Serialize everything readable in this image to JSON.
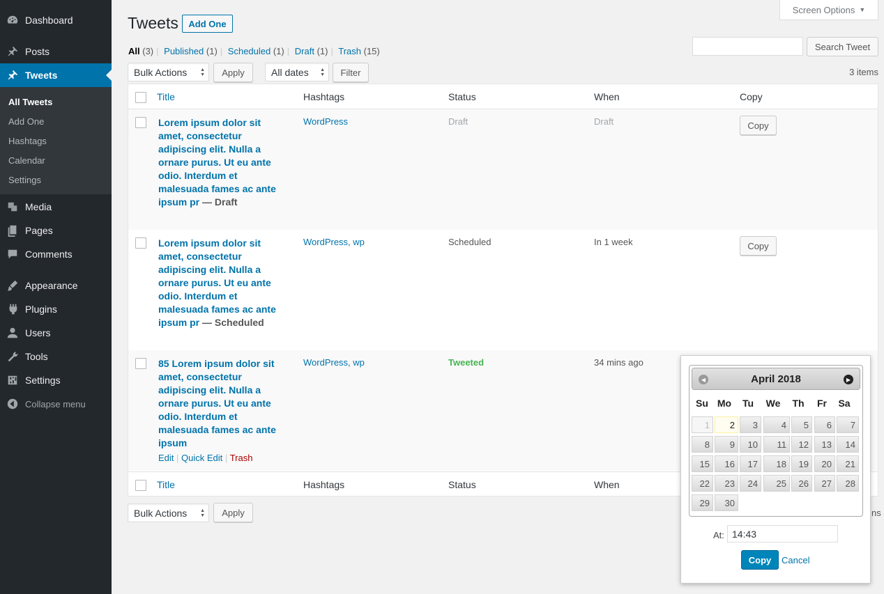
{
  "sidebar": {
    "dashboard": "Dashboard",
    "posts": "Posts",
    "tweets": "Tweets",
    "submenu": [
      "All Tweets",
      "Add One",
      "Hashtags",
      "Calendar",
      "Settings"
    ],
    "media": "Media",
    "pages": "Pages",
    "comments": "Comments",
    "appearance": "Appearance",
    "plugins": "Plugins",
    "users": "Users",
    "tools": "Tools",
    "settings": "Settings",
    "collapse": "Collapse menu"
  },
  "header": {
    "title": "Tweets",
    "add_one": "Add One",
    "screen_options": "Screen Options",
    "screen_options_caret": "▼"
  },
  "views": [
    {
      "label": "All",
      "count": "(3)"
    },
    {
      "label": "Published",
      "count": "(1)"
    },
    {
      "label": "Scheduled",
      "count": "(1)"
    },
    {
      "label": "Draft",
      "count": "(1)"
    },
    {
      "label": "Trash",
      "count": "(15)"
    }
  ],
  "views_sep": "|",
  "search": {
    "value": "",
    "button": "Search Tweet"
  },
  "filters": {
    "bulk_actions": "Bulk Actions",
    "apply": "Apply",
    "dates": "All dates",
    "filter": "Filter",
    "items": "3 items"
  },
  "columns": {
    "title": "Title",
    "hashtags": "Hashtags",
    "status": "Status",
    "when": "When",
    "copy": "Copy"
  },
  "rows": [
    {
      "title": "Lorem ipsum dolor sit amet, consectetur adipiscing elit. Nulla a ornare purus. Ut eu ante odio. Interdum et malesuada fames ac ante ipsum pr",
      "state": " — Draft",
      "hashtags": "WordPress",
      "status": "Draft",
      "when": "Draft",
      "copy": "Copy"
    },
    {
      "title": "Lorem ipsum dolor sit amet, consectetur adipiscing elit. Nulla a ornare purus. Ut eu ante odio. Interdum et malesuada fames ac ante ipsum pr",
      "state": " — Scheduled",
      "hashtags": "WordPress, wp",
      "status": "Scheduled",
      "when": "In 1 week",
      "copy": "Copy"
    },
    {
      "title": "85 Lorem ipsum dolor sit amet, consectetur adipiscing elit. Nulla a ornare purus. Ut eu ante odio. Interdum et malesuada fames ac ante ipsum",
      "state": "",
      "hashtags": "WordPress, wp",
      "status": "Tweeted",
      "when": "34 mins ago",
      "actions": {
        "edit": "Edit",
        "quick_edit": "Quick Edit",
        "trash": "Trash",
        "sep": "|"
      }
    }
  ],
  "bottom": {
    "partial_items": "ns"
  },
  "datepicker": {
    "month": "April 2018",
    "prev_icon": "◀",
    "next_icon": "▶",
    "days_of_week": [
      "Su",
      "Mo",
      "Tu",
      "We",
      "Th",
      "Fr",
      "Sa"
    ],
    "weeks": [
      [
        "1",
        "2",
        "3",
        "4",
        "5",
        "6",
        "7"
      ],
      [
        "8",
        "9",
        "10",
        "11",
        "12",
        "13",
        "14"
      ],
      [
        "15",
        "16",
        "17",
        "18",
        "19",
        "20",
        "21"
      ],
      [
        "22",
        "23",
        "24",
        "25",
        "26",
        "27",
        "28"
      ],
      [
        "29",
        "30"
      ]
    ],
    "at_label": "At:",
    "time": "14:43",
    "copy": "Copy",
    "cancel": "Cancel"
  },
  "colors": {
    "primary": "#0073aa",
    "sidebar": "#23282d",
    "tweeted": "#46b450",
    "trash": "#a00"
  }
}
